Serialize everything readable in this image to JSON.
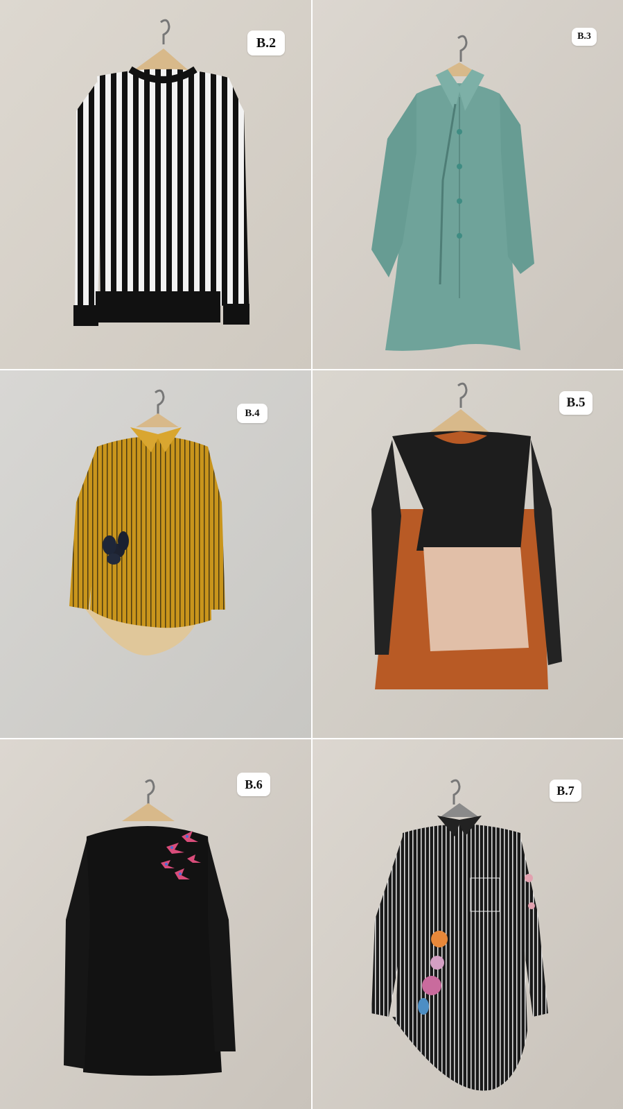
{
  "panels": [
    {
      "label": "B.2",
      "garment": "black and white vertical striped long-sleeve top with black ribbed hem"
    },
    {
      "label": "B.3",
      "garment": "sage green collared tunic with buttons and neck tie"
    },
    {
      "label": "B.4",
      "garment": "mustard yellow striped collared shirt with dark flower appliqué"
    },
    {
      "label": "B.5",
      "garment": "black, rust and beige colour-block blouse"
    },
    {
      "label": "B.6",
      "garment": "black long-sleeve top with embroidered birds"
    },
    {
      "label": "B.7",
      "garment": "black and white pinstripe shirt with floral print and pocket"
    }
  ],
  "colors": {
    "wall": "#d9d4cc",
    "label_bg": "#ffffff",
    "hanger": "#d8b98a"
  }
}
